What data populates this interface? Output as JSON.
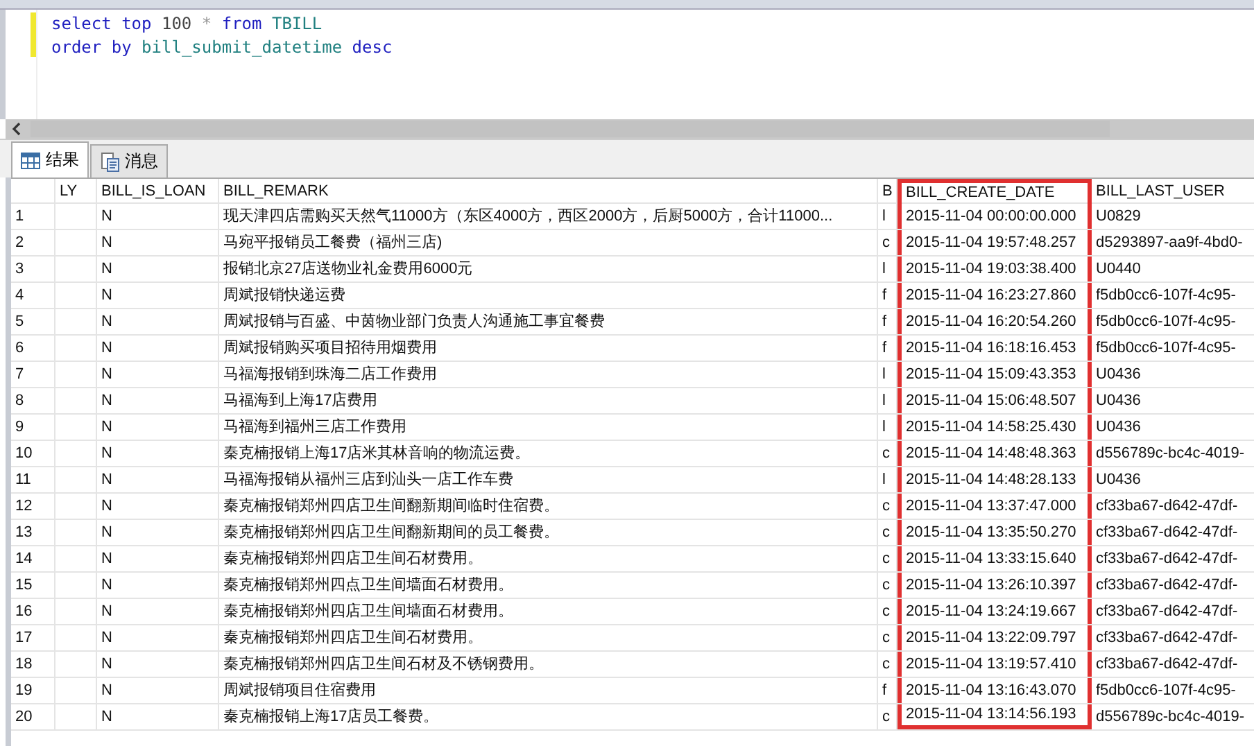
{
  "editor": {
    "lines": [
      [
        {
          "kind": "keyword",
          "text": "select"
        },
        {
          "kind": "keyword",
          "text": "top"
        },
        {
          "kind": "number",
          "text": "100"
        },
        {
          "kind": "operator",
          "text": "*"
        },
        {
          "kind": "keyword",
          "text": "from"
        },
        {
          "kind": "identifier",
          "text": "TBILL"
        }
      ],
      [
        {
          "kind": "keyword",
          "text": "order"
        },
        {
          "kind": "keyword",
          "text": "by"
        },
        {
          "kind": "identifier",
          "text": "bill_submit_datetime"
        },
        {
          "kind": "keyword",
          "text": "desc"
        }
      ]
    ]
  },
  "tabs": [
    {
      "label": "结果",
      "selected": true
    },
    {
      "label": "消息",
      "selected": false
    }
  ],
  "table": {
    "columns": [
      {
        "highlighted": false
      },
      {
        "label": "LY",
        "highlighted": false
      },
      {
        "label": "BILL_IS_LOAN",
        "highlighted": false
      },
      {
        "label": "BILL_REMARK",
        "highlighted": false
      },
      {
        "label": "B",
        "highlighted": false
      },
      {
        "label": "BILL_CREATE_DATE",
        "highlighted": true
      },
      {
        "label": "BILL_LAST_USER",
        "highlighted": false
      }
    ],
    "rows": [
      [
        "1",
        "",
        "N",
        "现天津四店需购买天然气11000方（东区4000方，西区2000方，后厨5000方，合计11000...",
        "l",
        "2015-11-04 00:00:00.000",
        "U0829"
      ],
      [
        "2",
        "",
        "N",
        "马宛平报销员工餐费（福州三店)",
        "c",
        "2015-11-04 19:57:48.257",
        "d5293897-aa9f-4bd0-"
      ],
      [
        "3",
        "",
        "N",
        "报销北京27店送物业礼金费用6000元",
        "l",
        "2015-11-04 19:03:38.400",
        "U0440"
      ],
      [
        "4",
        "",
        "N",
        "周斌报销快递运费",
        "f",
        "2015-11-04 16:23:27.860",
        "f5db0cc6-107f-4c95-"
      ],
      [
        "5",
        "",
        "N",
        "周斌报销与百盛、中茵物业部门负责人沟通施工事宜餐费",
        "f",
        "2015-11-04 16:20:54.260",
        "f5db0cc6-107f-4c95-"
      ],
      [
        "6",
        "",
        "N",
        "周斌报销购买项目招待用烟费用",
        "f",
        "2015-11-04 16:18:16.453",
        "f5db0cc6-107f-4c95-"
      ],
      [
        "7",
        "",
        "N",
        "马福海报销到珠海二店工作费用",
        "l",
        "2015-11-04 15:09:43.353",
        "U0436"
      ],
      [
        "8",
        "",
        "N",
        "马福海到上海17店费用",
        "l",
        "2015-11-04 15:06:48.507",
        "U0436"
      ],
      [
        "9",
        "",
        "N",
        "马福海到福州三店工作费用",
        "l",
        "2015-11-04 14:58:25.430",
        "U0436"
      ],
      [
        "10",
        "",
        "N",
        "秦克楠报销上海17店米其林音响的物流运费。",
        "c",
        "2015-11-04 14:48:48.363",
        "d556789c-bc4c-4019-"
      ],
      [
        "11",
        "",
        "N",
        "马福海报销从福州三店到汕头一店工作车费",
        "l",
        "2015-11-04 14:48:28.133",
        "U0436"
      ],
      [
        "12",
        "",
        "N",
        "秦克楠报销郑州四店卫生间翻新期间临时住宿费。",
        "c",
        "2015-11-04 13:37:47.000",
        "cf33ba67-d642-47df-"
      ],
      [
        "13",
        "",
        "N",
        "秦克楠报销郑州四店卫生间翻新期间的员工餐费。",
        "c",
        "2015-11-04 13:35:50.270",
        "cf33ba67-d642-47df-"
      ],
      [
        "14",
        "",
        "N",
        "秦克楠报销郑州四店卫生间石材费用。",
        "c",
        "2015-11-04 13:33:15.640",
        "cf33ba67-d642-47df-"
      ],
      [
        "15",
        "",
        "N",
        "秦克楠报销郑州四点卫生间墙面石材费用。",
        "c",
        "2015-11-04 13:26:10.397",
        "cf33ba67-d642-47df-"
      ],
      [
        "16",
        "",
        "N",
        "秦克楠报销郑州四店卫生间墙面石材费用。",
        "c",
        "2015-11-04 13:24:19.667",
        "cf33ba67-d642-47df-"
      ],
      [
        "17",
        "",
        "N",
        "秦克楠报销郑州四店卫生间石材费用。",
        "c",
        "2015-11-04 13:22:09.797",
        "cf33ba67-d642-47df-"
      ],
      [
        "18",
        "",
        "N",
        "秦克楠报销郑州四店卫生间石材及不锈钢费用。",
        "c",
        "2015-11-04 13:19:57.410",
        "cf33ba67-d642-47df-"
      ],
      [
        "19",
        "",
        "N",
        "周斌报销项目住宿费用",
        "f",
        "2015-11-04 13:16:43.070",
        "f5db0cc6-107f-4c95-"
      ],
      [
        "20",
        "",
        "N",
        "秦克楠报销上海17店员工餐费。",
        "c",
        "2015-11-04 13:14:56.193",
        "d556789c-bc4c-4019-"
      ]
    ]
  }
}
